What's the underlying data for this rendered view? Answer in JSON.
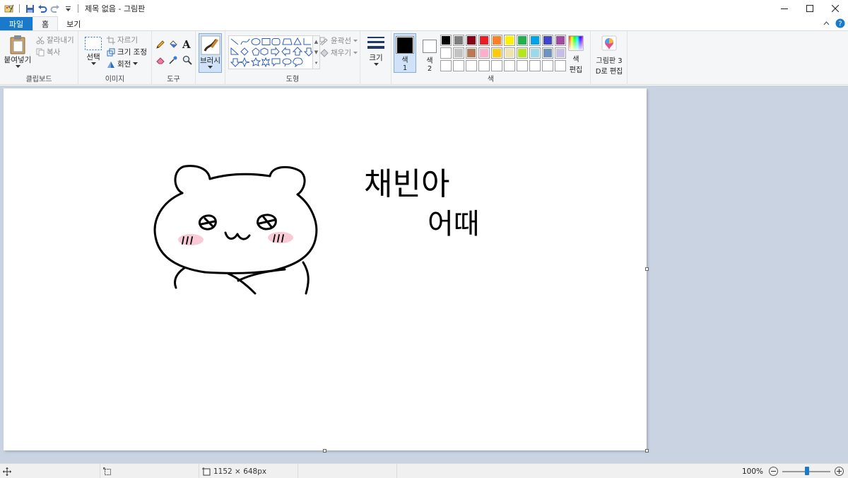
{
  "window": {
    "title": "제목 없음 - 그림판",
    "minimize": "─",
    "maximize": "☐",
    "close": "✕"
  },
  "tabs": {
    "file": "파일",
    "home": "홈",
    "view": "보기"
  },
  "ribbon": {
    "clipboard": {
      "paste": "붙여넣기",
      "cut": "잘라내기",
      "copy": "복사",
      "label": "클립보드"
    },
    "image": {
      "select": "선택",
      "crop": "자르기",
      "resize": "크기 조정",
      "rotate": "회전",
      "label": "이미지"
    },
    "tools": {
      "label": "도구",
      "text_glyph": "A"
    },
    "brushes": {
      "label": "브러시"
    },
    "shapes": {
      "outline": "윤곽선",
      "fill": "채우기",
      "label": "도형"
    },
    "size": {
      "label": "크기"
    },
    "colors": {
      "color1": "색",
      "color1_num": "1",
      "color2": "색",
      "color2_num": "2",
      "edit": "색 편집",
      "edit_line1": "색",
      "edit_line2": "편집",
      "label": "색",
      "color1_value": "#000000",
      "color2_value": "#ffffff",
      "palette": [
        "#000000",
        "#7f7f7f",
        "#880015",
        "#ed1c24",
        "#ff7f27",
        "#fff200",
        "#22b14c",
        "#00a2e8",
        "#3f48cc",
        "#a349a4",
        "#ffffff",
        "#c3c3c3",
        "#b97a57",
        "#ffaec9",
        "#ffc90e",
        "#efe4b0",
        "#b5e61d",
        "#99d9ea",
        "#7092be",
        "#c8bfe7",
        "#ffffff",
        "#ffffff",
        "#ffffff",
        "#ffffff",
        "#ffffff",
        "#ffffff",
        "#ffffff",
        "#ffffff",
        "#ffffff",
        "#ffffff"
      ]
    },
    "paint3d": {
      "line1": "그림판 3",
      "line2": "D로 편집"
    }
  },
  "status": {
    "image_size": "1152 × 648px",
    "zoom": "100%",
    "zoom_value": 100
  },
  "canvas_text": {
    "line1": "채빈아",
    "line2": "어때"
  }
}
